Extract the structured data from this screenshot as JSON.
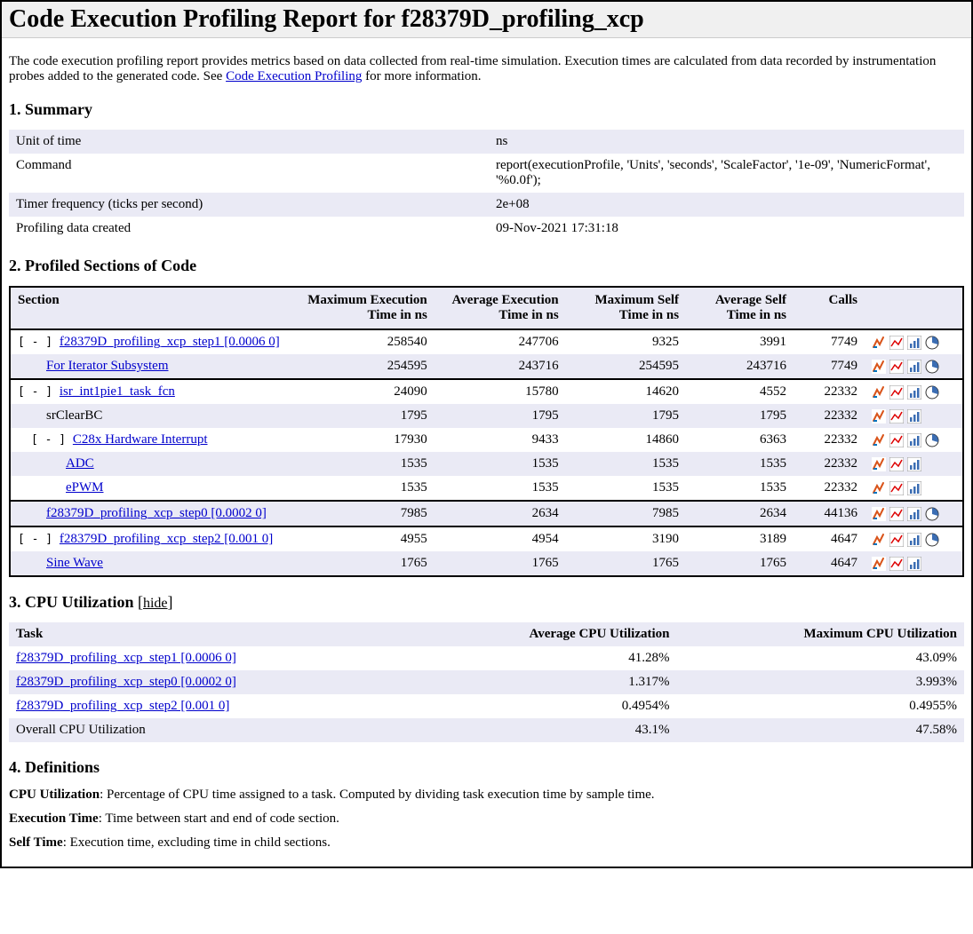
{
  "title": "Code Execution Profiling Report for f28379D_profiling_xcp",
  "intro_before_link": "The code execution profiling report provides metrics based on data collected from real-time simulation. Execution times are calculated from data recorded by instrumentation probes added to the generated code. See ",
  "intro_link_text": "Code Execution Profiling",
  "intro_after_link": " for more information.",
  "headings": {
    "summary": "1. Summary",
    "profiled": "2. Profiled Sections of Code",
    "cpu": "3. CPU Utilization",
    "defs": "4. Definitions"
  },
  "hide_label": "hide",
  "summary_rows": [
    {
      "label": "Unit of time",
      "value": "ns"
    },
    {
      "label": "Command",
      "value": "report(executionProfile, 'Units', 'seconds', 'ScaleFactor', '1e-09', 'NumericFormat', '%0.0f');"
    },
    {
      "label": "Timer frequency (ticks per second)",
      "value": "2e+08"
    },
    {
      "label": "Profiling data created",
      "value": "09-Nov-2021 17:31:18"
    }
  ],
  "profiled_headers": {
    "section": "Section",
    "max_exec": "Maximum Execution Time in ns",
    "avg_exec": "Average Execution Time in ns",
    "max_self": "Maximum Self Time in ns",
    "avg_self": "Average Self Time in ns",
    "calls": "Calls"
  },
  "toggle_label": "[ - ]",
  "profiled_rows": [
    {
      "group_start": true,
      "zebra": false,
      "toggle": true,
      "indent": 0,
      "link": true,
      "name": "f28379D_profiling_xcp_step1 [0.0006 0]",
      "max_exec": "258540",
      "avg_exec": "247706",
      "max_self": "9325",
      "avg_self": "3991",
      "calls": "7749",
      "pie": true
    },
    {
      "zebra": true,
      "toggle": false,
      "indent": 1,
      "link": true,
      "name": "For Iterator Subsystem",
      "max_exec": "254595",
      "avg_exec": "243716",
      "max_self": "254595",
      "avg_self": "243716",
      "calls": "7749",
      "pie": true
    },
    {
      "group_start": true,
      "zebra": false,
      "toggle": true,
      "indent": 0,
      "link": true,
      "name": "isr_int1pie1_task_fcn",
      "max_exec": "24090",
      "avg_exec": "15780",
      "max_self": "14620",
      "avg_self": "4552",
      "calls": "22332",
      "pie": true
    },
    {
      "zebra": true,
      "toggle": false,
      "indent": 1,
      "link": false,
      "name": "srClearBC",
      "max_exec": "1795",
      "avg_exec": "1795",
      "max_self": "1795",
      "avg_self": "1795",
      "calls": "22332",
      "pie": false
    },
    {
      "zebra": false,
      "toggle": true,
      "indent": 1,
      "toggle_indent": true,
      "link": true,
      "name": "C28x Hardware Interrupt",
      "max_exec": "17930",
      "avg_exec": "9433",
      "max_self": "14860",
      "avg_self": "6363",
      "calls": "22332",
      "pie": true
    },
    {
      "zebra": true,
      "toggle": false,
      "indent": 2,
      "link": true,
      "name": "ADC",
      "max_exec": "1535",
      "avg_exec": "1535",
      "max_self": "1535",
      "avg_self": "1535",
      "calls": "22332",
      "pie": false
    },
    {
      "zebra": false,
      "toggle": false,
      "indent": 2,
      "link": true,
      "name": "ePWM",
      "max_exec": "1535",
      "avg_exec": "1535",
      "max_self": "1535",
      "avg_self": "1535",
      "calls": "22332",
      "pie": false
    },
    {
      "group_start": true,
      "zebra": true,
      "toggle": false,
      "indent": 1,
      "link": true,
      "name": "f28379D_profiling_xcp_step0 [0.0002 0]",
      "max_exec": "7985",
      "avg_exec": "2634",
      "max_self": "7985",
      "avg_self": "2634",
      "calls": "44136",
      "pie": true
    },
    {
      "group_start": true,
      "zebra": false,
      "toggle": true,
      "indent": 0,
      "link": true,
      "name": "f28379D_profiling_xcp_step2 [0.001 0]",
      "max_exec": "4955",
      "avg_exec": "4954",
      "max_self": "3190",
      "avg_self": "3189",
      "calls": "4647",
      "pie": true
    },
    {
      "zebra": true,
      "toggle": false,
      "indent": 1,
      "link": true,
      "name": "Sine Wave",
      "max_exec": "1765",
      "avg_exec": "1765",
      "max_self": "1765",
      "avg_self": "1765",
      "calls": "4647",
      "pie": false
    }
  ],
  "cpu_headers": {
    "task": "Task",
    "avg": "Average CPU Utilization",
    "max": "Maximum CPU Utilization"
  },
  "cpu_rows": [
    {
      "link": true,
      "task": "f28379D_profiling_xcp_step1 [0.0006 0]",
      "avg": "41.28%",
      "max": "43.09%"
    },
    {
      "link": true,
      "task": "f28379D_profiling_xcp_step0 [0.0002 0]",
      "avg": "1.317%",
      "max": "3.993%"
    },
    {
      "link": true,
      "task": "f28379D_profiling_xcp_step2 [0.001 0]",
      "avg": "0.4954%",
      "max": "0.4955%"
    },
    {
      "link": false,
      "task": "Overall CPU Utilization",
      "avg": "43.1%",
      "max": "47.58%"
    }
  ],
  "definitions": [
    {
      "term": "CPU Utilization",
      "def": ": Percentage of CPU time assigned to a task. Computed by dividing task execution time by sample time."
    },
    {
      "term": "Execution Time",
      "def": ": Time between start and end of code section."
    },
    {
      "term": "Self Time",
      "def": ": Execution time, excluding time in child sections."
    }
  ]
}
